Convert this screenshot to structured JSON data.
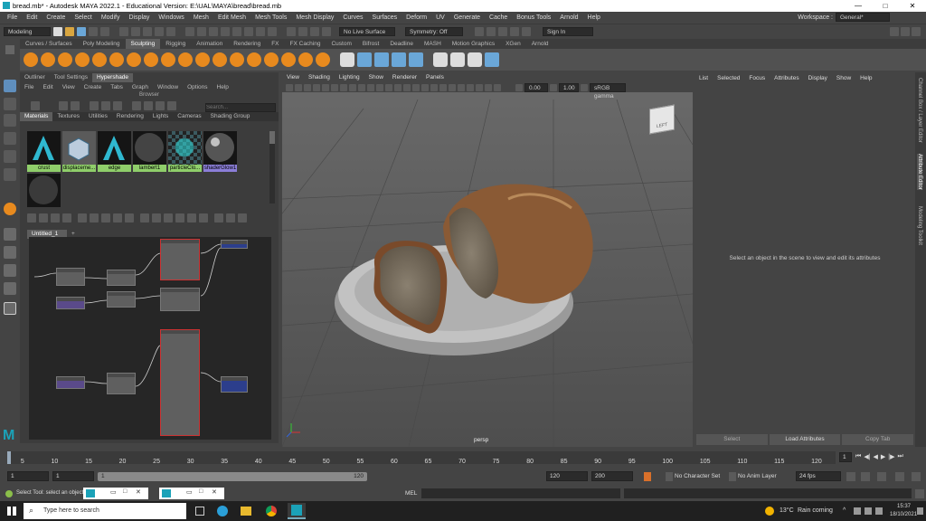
{
  "title_bar": {
    "title": "bread.mb* - Autodesk MAYA 2022.1 - Educational Version: E:\\UAL\\MAYA\\bread\\bread.mb",
    "minimize": "—",
    "maximize": "□",
    "close": "✕"
  },
  "menu": {
    "items": [
      "File",
      "Edit",
      "Create",
      "Select",
      "Modify",
      "Display",
      "Windows",
      "Mesh",
      "Edit Mesh",
      "Mesh Tools",
      "Mesh Display",
      "Curves",
      "Surfaces",
      "Deform",
      "UV",
      "Generate",
      "Cache",
      "Bonus Tools",
      "Arnold",
      "Help"
    ],
    "workspace_label": "Workspace :",
    "workspace_value": "General*"
  },
  "status_line": {
    "menu_set": "Modeling",
    "live_surface": "No Live Surface",
    "symmetry": "Symmetry: Off",
    "sign_in": "Sign In"
  },
  "shelf_tabs": [
    "Curves / Surfaces",
    "Poly Modeling",
    "Sculpting",
    "Rigging",
    "Animation",
    "Rendering",
    "FX",
    "FX Caching",
    "Custom",
    "Bifrost",
    "Deadline",
    "MASH",
    "Motion Graphics",
    "XGen",
    "Arnold"
  ],
  "shelf_active": "Sculpting",
  "hypershade": {
    "top_tabs": [
      "Outliner",
      "Tool Settings",
      "Hypershade"
    ],
    "menu": [
      "File",
      "Edit",
      "View",
      "Create",
      "Tabs",
      "Graph",
      "Window",
      "Options",
      "Help"
    ],
    "browser_label": "Browser",
    "search_placeholder": "Search...",
    "browser_tabs": [
      "Materials",
      "Textures",
      "Utilities",
      "Rendering",
      "Lights",
      "Cameras",
      "Shading Group"
    ],
    "materials": [
      {
        "name": "crust",
        "label_color": "#8fce6a"
      },
      {
        "name": "displaceme...",
        "label_color": "#8fce6a"
      },
      {
        "name": "edge",
        "label_color": "#8fce6a"
      },
      {
        "name": "lambert1",
        "label_color": "#8fce6a"
      },
      {
        "name": "particleClo...",
        "label_color": "#8fce6a"
      },
      {
        "name": "shaderGlow1",
        "label_color": "#8b7ed8"
      }
    ],
    "graph_tab": "Untitled_1",
    "graph_add": "+"
  },
  "viewport": {
    "menu": [
      "View",
      "Shading",
      "Lighting",
      "Show",
      "Renderer",
      "Panels"
    ],
    "exposure": "0.00",
    "gamma": "1.00",
    "color_space": "sRGB gamma",
    "camera_label": "persp",
    "viewcube_label": "LEFT"
  },
  "attribute_editor": {
    "menu": [
      "List",
      "Selected",
      "Focus",
      "Attributes",
      "Display",
      "Show",
      "Help"
    ],
    "message": "Select an object in the scene to view and edit its attributes",
    "buttons": [
      "Select",
      "Load Attributes",
      "Copy Tab"
    ]
  },
  "side_tabs": [
    "Channel Box / Layer Editor",
    "Attribute Editor",
    "Modeling Toolkit"
  ],
  "time_slider": {
    "ticks": [
      "5",
      "10",
      "15",
      "20",
      "25",
      "30",
      "35",
      "40",
      "45",
      "50",
      "55",
      "60",
      "65",
      "70",
      "75",
      "80",
      "85",
      "90",
      "95",
      "100",
      "105",
      "110",
      "115",
      "120"
    ],
    "current": "1"
  },
  "range_slider": {
    "start": "1",
    "playback_start": "1",
    "range_start_value": "1",
    "range_end_value": "120",
    "playback_end": "120",
    "end": "200",
    "character_set": "No Character Set",
    "anim_layer": "No Anim Layer",
    "fps": "24 fps"
  },
  "command_line": {
    "mel_label": "MEL",
    "help_text": "Select Tool: select an object"
  },
  "taskbar": {
    "search_placeholder": "Type here to search",
    "temperature": "13°C",
    "weather": "Rain coming",
    "time": "15:37",
    "date": "18/10/2021"
  }
}
